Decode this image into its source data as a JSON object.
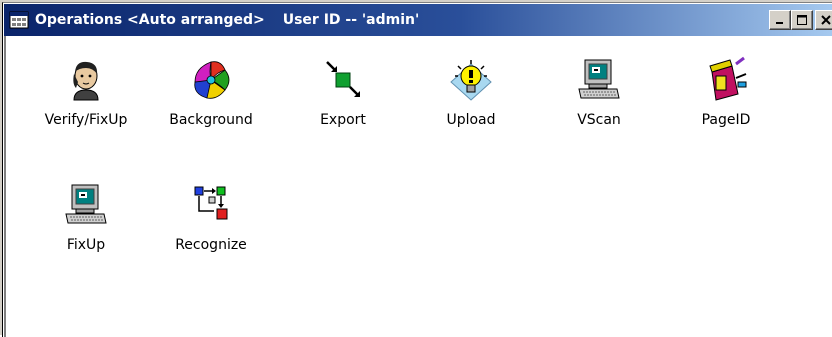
{
  "window": {
    "title_main": "Operations <Auto arranged>",
    "title_user": "User ID -- 'admin'"
  },
  "icons": [
    {
      "label": "Verify/FixUp",
      "icon": "person-head-icon"
    },
    {
      "label": "Background",
      "icon": "colored-puzzle-icon"
    },
    {
      "label": "Export",
      "icon": "export-arrows-icon"
    },
    {
      "label": "Upload",
      "icon": "lightbulb-icon"
    },
    {
      "label": "VScan",
      "icon": "computer-terminal-icon"
    },
    {
      "label": "PageID",
      "icon": "paint-bucket-icon"
    },
    {
      "label": "FixUp",
      "icon": "computer-terminal-icon"
    },
    {
      "label": "Recognize",
      "icon": "flow-diagram-icon"
    }
  ],
  "colors": {
    "titlebar_start": "#0a246a",
    "titlebar_end": "#a6caf0",
    "button_face": "#d4d0c8"
  }
}
